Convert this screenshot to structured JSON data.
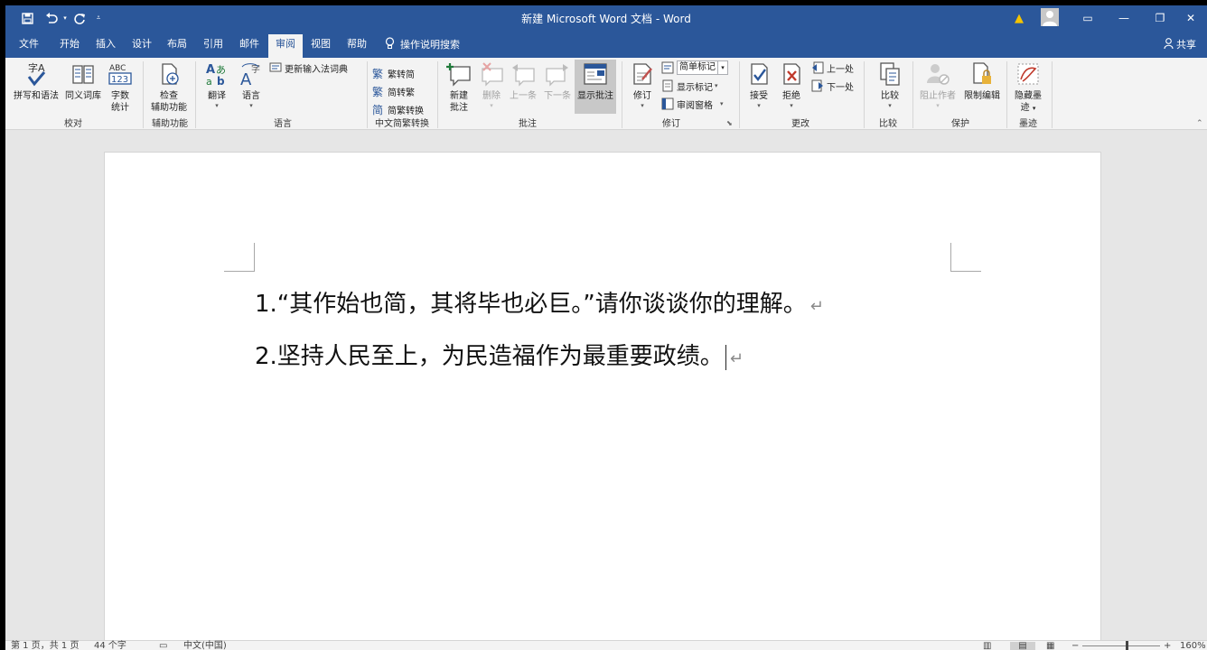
{
  "titlebar": {
    "title": "新建 Microsoft Word 文档 - Word",
    "quick_access": [
      "save",
      "undo",
      "redo",
      "customize"
    ],
    "warning_glyph": "▲",
    "ribbon_display_glyph": "▭",
    "minimize_glyph": "—",
    "restore_glyph": "❐",
    "close_glyph": "✕"
  },
  "tabs": [
    "文件",
    "开始",
    "插入",
    "设计",
    "布局",
    "引用",
    "邮件",
    "审阅",
    "视图",
    "帮助"
  ],
  "active_tab": "审阅",
  "tell_me": "操作说明搜索",
  "share": "共享",
  "ribbon": {
    "proofing": {
      "label": "校对",
      "spelling": "拼写和语法",
      "thesaurus": "同义词库",
      "wordcount_1": "字数",
      "wordcount_2": "统计"
    },
    "accessibility": {
      "label": "辅助功能",
      "check_1": "检查",
      "check_2": "辅助功能"
    },
    "language": {
      "label": "语言",
      "translate": "翻译",
      "language": "语言",
      "update_ime": "更新输入法词典"
    },
    "chinese": {
      "label": "中文简繁转换",
      "to_traditional": "繁转简",
      "to_simplified": "简转繁",
      "convert": "简繁转换"
    },
    "comments": {
      "label": "批注",
      "new_1": "新建",
      "new_2": "批注",
      "delete": "删除",
      "previous": "上一条",
      "next": "下一条",
      "show": "显示批注"
    },
    "tracking": {
      "label": "修订",
      "track": "修订",
      "markup": "简单标记",
      "show_markup": "显示标记",
      "pane": "审阅窗格"
    },
    "changes": {
      "label": "更改",
      "accept": "接受",
      "reject": "拒绝",
      "previous": "上一处",
      "next": "下一处"
    },
    "compare": {
      "label": "比较",
      "compare": "比较"
    },
    "protect": {
      "label": "保护",
      "block_authors": "阻止作者",
      "restrict": "限制编辑"
    },
    "ink": {
      "label": "墨迹",
      "hide_1": "隐藏墨",
      "hide_2": "迹"
    }
  },
  "document": {
    "paragraphs": [
      "1.“其作始也简，其将毕也必巨。”请你谈谈你的理解。",
      "2.坚持人民至上，为民造福作为最重要政绩。"
    ],
    "paragraph_mark": "↵"
  },
  "statusbar": {
    "page": "第 1 页，共 1 页",
    "words": "44 个字",
    "language": "中文(中国)",
    "zoom": "160%",
    "zoom_minus": "−",
    "zoom_plus": "+"
  },
  "colors": {
    "brand": "#2b579a",
    "ribbon_bg": "#f3f3f3",
    "canvas_bg": "#e6e6e6"
  }
}
